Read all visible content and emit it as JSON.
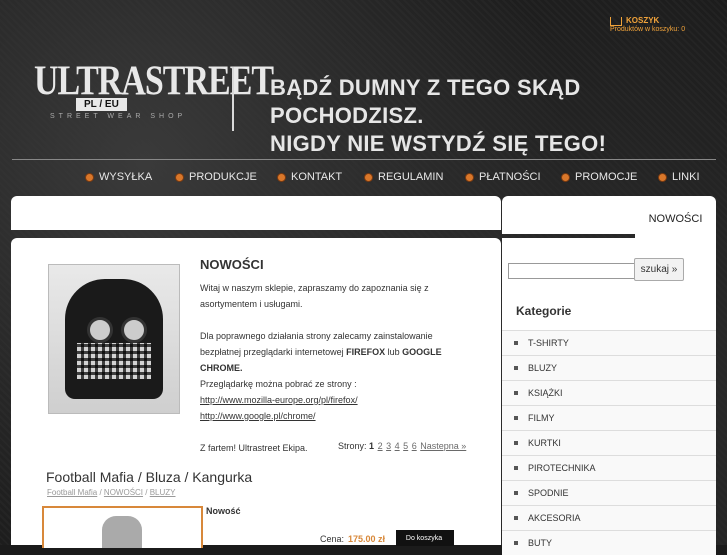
{
  "cart": {
    "title": "KOSZYK",
    "subtitle": "Produktów w koszyku: 0"
  },
  "logo": {
    "main": "ULTRASTREET",
    "domain": "PL / EU",
    "tag": "STREET WEAR SHOP"
  },
  "slogan": {
    "line1": "BĄDŹ DUMNY Z TEGO SKĄD POCHODZISZ.",
    "line2": "NIGDY NIE WSTYDŹ SIĘ TEGO!"
  },
  "nav": [
    "WYSYŁKA",
    "PRODUKCJE",
    "KONTAKT",
    "REGULAMIN",
    "PŁATNOŚCI",
    "PROMOCJE",
    "LINKI"
  ],
  "tab": {
    "label": "NOWOŚCI"
  },
  "news": {
    "title": "NOWOŚCI",
    "p1": "Witaj w naszym sklepie, zapraszamy do zapoznania się z asortymentem i usługami.",
    "p2a": "Dla poprawnego działania strony zalecamy zainstalowanie bezpłatnej przeglądarki internetowej ",
    "firefox": "FIREFOX",
    "lub": " lub ",
    "chrome": "GOOGLE CHROME.",
    "p3": "Przeglądarkę można pobrać ze strony :",
    "link1": "http://www.mozilla-europe.org/pl/firefox/",
    "link2": "http://www.google.pl/chrome/",
    "p4": "Z fartem! Ultrastreet Ekipa."
  },
  "pagination": {
    "label": "Strony:",
    "current": "1",
    "pages": [
      "2",
      "3",
      "4",
      "5",
      "6"
    ],
    "next": "Nastepna »"
  },
  "product": {
    "title": "Football Mafia / Bluza / Kangurka",
    "crumbs": [
      "Football Mafia",
      "NOWOŚCI",
      "BLUZY"
    ],
    "badge": "Nowość",
    "price_label": "Cena:",
    "price": "175.00 zł",
    "buy": "Do koszyka"
  },
  "search": {
    "button": "szukaj »"
  },
  "categories": {
    "title": "Kategorie",
    "items": [
      "T-SHIRTY",
      "BLUZY",
      "KSIĄŻKI",
      "FILMY",
      "KURTKI",
      "PIROTECHNIKA",
      "SPODNIE",
      "AKCESORIA",
      "BUTY"
    ]
  }
}
